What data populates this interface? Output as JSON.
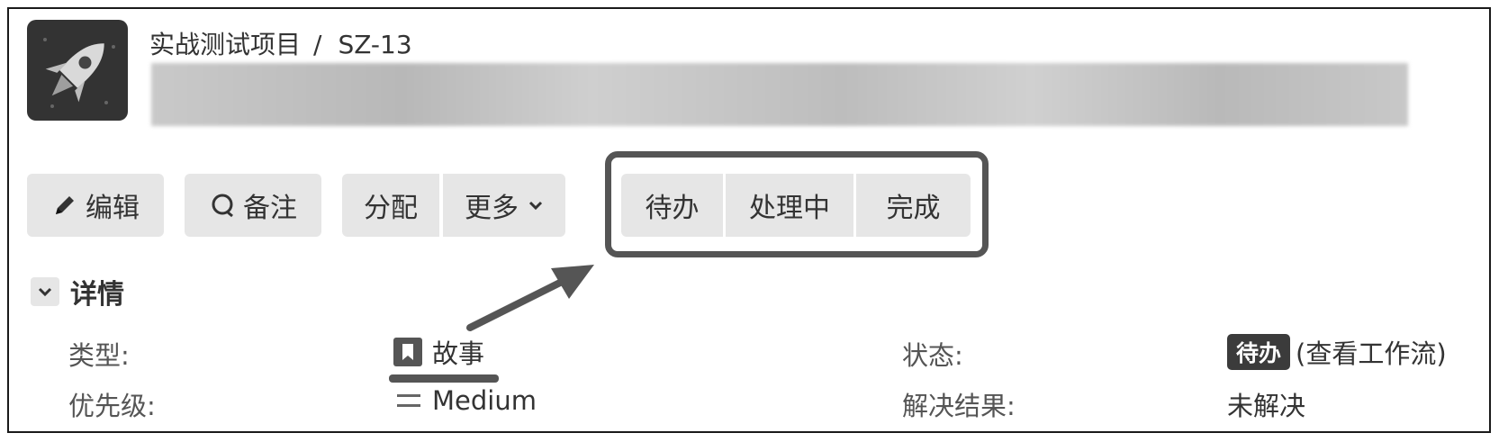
{
  "breadcrumb": {
    "project": "实战测试项目",
    "separator": "/",
    "issue_key": "SZ-13"
  },
  "toolbar": {
    "edit": "编辑",
    "comment": "备注",
    "assign": "分配",
    "more": "更多",
    "workflow": [
      "待办",
      "处理中",
      "完成"
    ]
  },
  "details": {
    "title": "详情",
    "type_label": "类型:",
    "type_value": "故事",
    "priority_label": "优先级:",
    "priority_value": "Medium",
    "status_label": "状态:",
    "status_value": "待办",
    "status_link": "(查看工作流)",
    "resolution_label": "解决结果:",
    "resolution_value": "未解决"
  },
  "icons": {
    "avatar": "rocket-icon",
    "edit": "pencil-icon",
    "comment": "comment-icon",
    "more": "chevron-down-icon",
    "section": "chevron-down-icon",
    "type": "bookmark-icon",
    "priority": "equals-icon"
  }
}
